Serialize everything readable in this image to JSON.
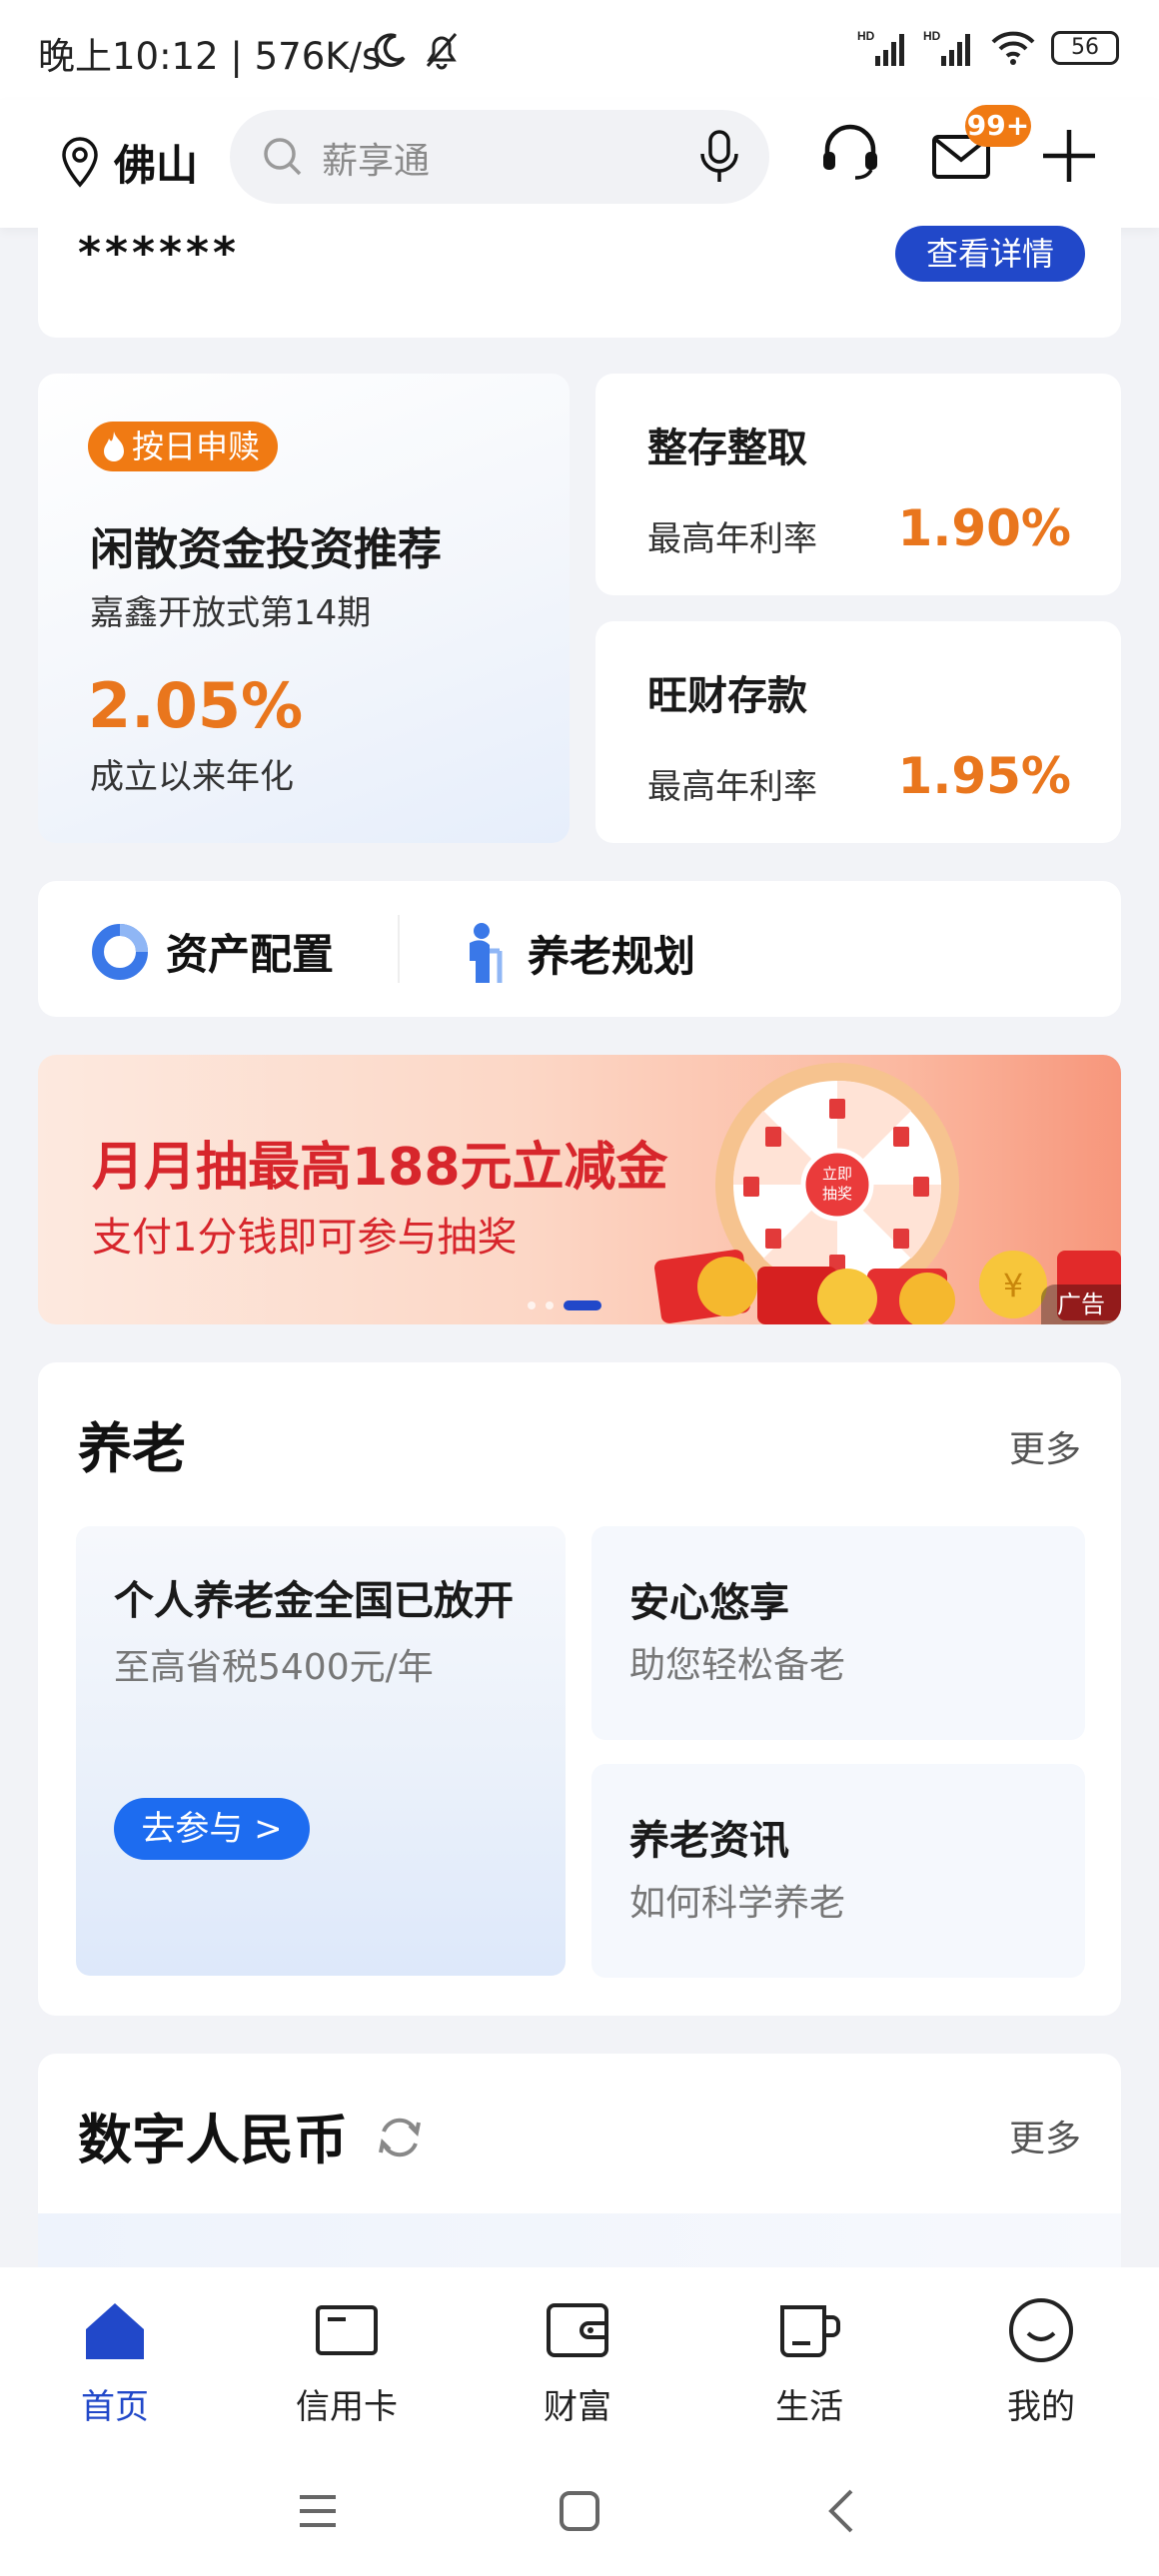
{
  "status_bar": {
    "time": "晚上10:12 | 576K/s",
    "battery": "56"
  },
  "header": {
    "city": "佛山",
    "search_placeholder": "薪享通",
    "mail_badge": "99+"
  },
  "top_card": {
    "masked_value": "******",
    "detail_button": "查看详情"
  },
  "featured_product": {
    "tag": "按日申赎",
    "title": "闲散资金投资推荐",
    "subtitle": "嘉鑫开放式第14期",
    "rate": "2.05%",
    "rate_label": "成立以来年化"
  },
  "products": [
    {
      "title": "整存整取",
      "rate_label": "最高年利率",
      "rate": "1.90%"
    },
    {
      "title": "旺财存款",
      "rate_label": "最高年利率",
      "rate": "1.95%"
    }
  ],
  "quick_links": [
    {
      "label": "资产配置",
      "icon": "pie-chart-icon"
    },
    {
      "label": "养老规划",
      "icon": "elderly-person-icon"
    }
  ],
  "banner": {
    "title": "月月抽最高188元立减金",
    "subtitle": "支付1分钱即可参与抽奖",
    "wheel_label_1": "立即",
    "wheel_label_2": "抽奖",
    "ad_tag": "广告",
    "active_dot": 3,
    "dot_count": 3
  },
  "pension": {
    "title": "养老",
    "more": "更多",
    "big_card": {
      "title": "个人养老金全国已放开",
      "subtitle": "至高省税5400元/年",
      "button": "去参与 >"
    },
    "small_cards": [
      {
        "title": "安心悠享",
        "subtitle": "助您轻松备老"
      },
      {
        "title": "养老资讯",
        "subtitle": "如何科学养老"
      }
    ]
  },
  "digital_rmb": {
    "title": "数字人民币",
    "more": "更多"
  },
  "bottom_nav": [
    {
      "label": "首页",
      "icon": "home-icon",
      "active": true
    },
    {
      "label": "信用卡",
      "icon": "credit-card-icon",
      "active": false
    },
    {
      "label": "财富",
      "icon": "wallet-icon",
      "active": false
    },
    {
      "label": "生活",
      "icon": "cup-icon",
      "active": false
    },
    {
      "label": "我的",
      "icon": "smiley-face-icon",
      "active": false
    }
  ],
  "colors": {
    "brand_blue": "#2148c9",
    "accent_orange": "#e9761d",
    "banner_red": "#d7262c"
  }
}
